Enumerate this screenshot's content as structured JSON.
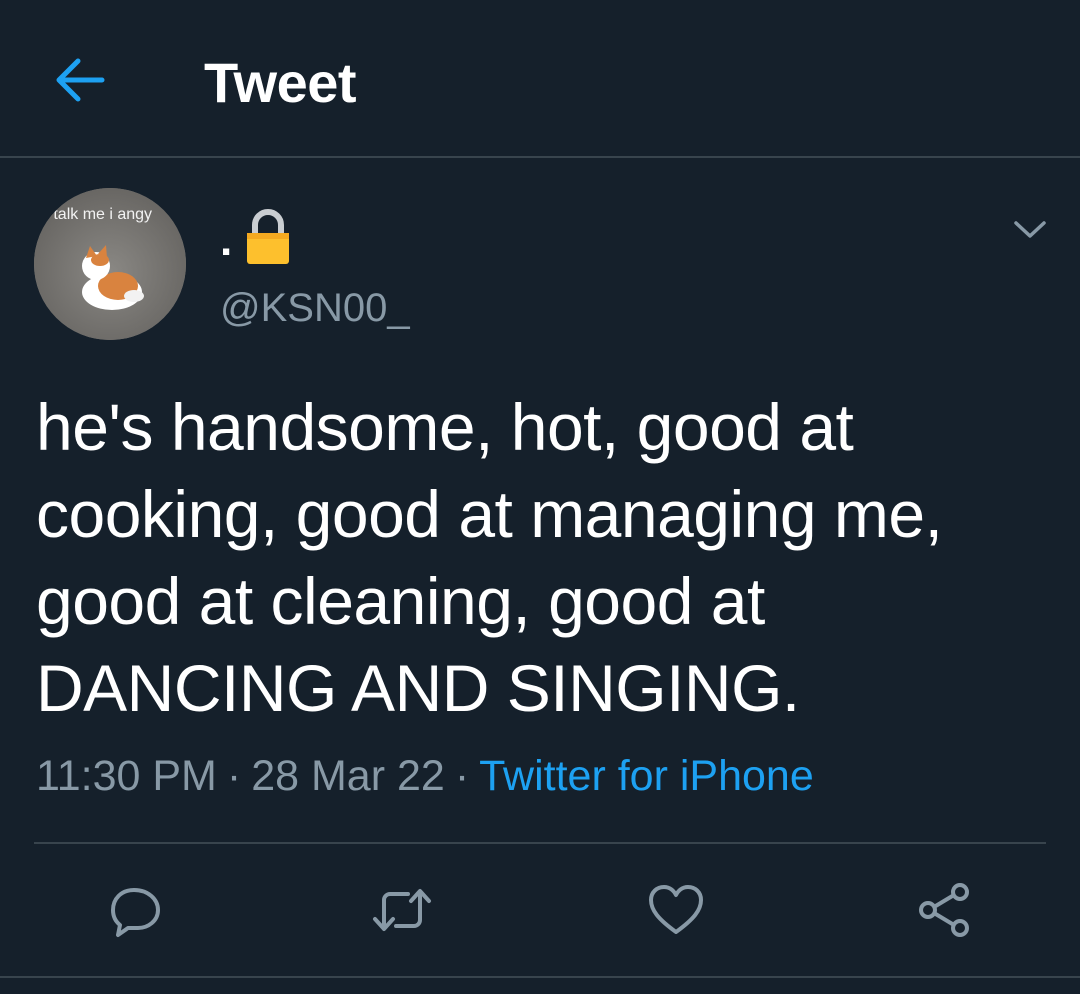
{
  "header": {
    "title": "Tweet",
    "back_icon": "arrow-left-icon"
  },
  "author": {
    "display_name": ".",
    "lock_icon": "lock-emoji-icon",
    "handle": "@KSN00_",
    "avatar_caption": "o talk me i angy"
  },
  "tweet": {
    "text": "he's handsome, hot, good at cooking, good at managing me, good at cleaning, good at DANCING AND SINGING.",
    "time": "11:30 PM",
    "date": "28 Mar 22",
    "separator": "·",
    "source": "Twitter for iPhone"
  },
  "actions": {
    "reply_icon": "reply-icon",
    "retweet_icon": "retweet-icon",
    "like_icon": "heart-icon",
    "share_icon": "share-icon"
  },
  "colors": {
    "background": "#15202b",
    "accent": "#1da1f2",
    "secondary_text": "#8899a6",
    "divider": "#38444d"
  }
}
